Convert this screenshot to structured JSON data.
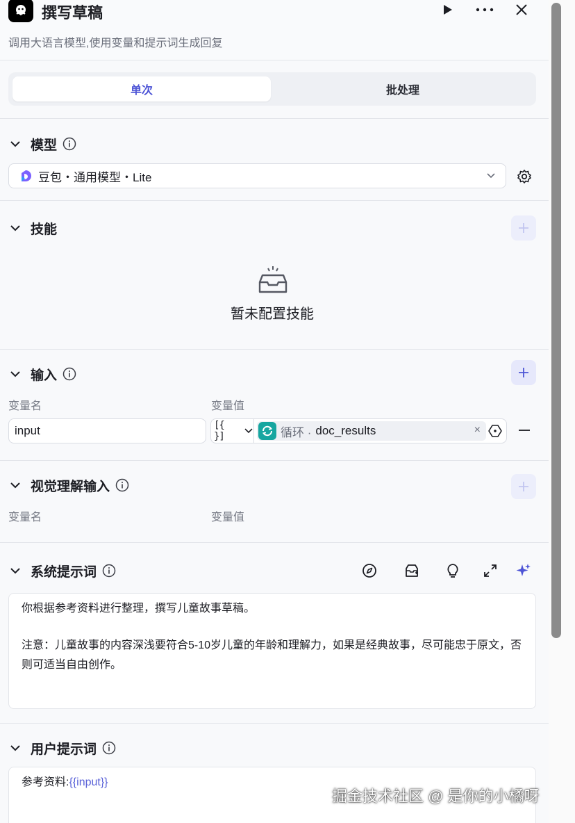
{
  "header": {
    "title": "撰写草稿",
    "subtitle": "调用大语言模型,使用变量和提示词生成回复"
  },
  "tabs": [
    {
      "label": "单次",
      "active": true
    },
    {
      "label": "批处理",
      "active": false
    }
  ],
  "model_section": {
    "title": "模型",
    "selected_model": "豆包・通用模型・Lite"
  },
  "skills_section": {
    "title": "技能",
    "empty_text": "暂未配置技能"
  },
  "input_section": {
    "title": "输入",
    "col_name": "变量名",
    "col_value": "变量值",
    "row": {
      "name": "input",
      "type_glyph": "[{ }]",
      "ref_node": "循环 ·",
      "ref_var": "doc_results"
    }
  },
  "vision_section": {
    "title": "视觉理解输入",
    "col_name": "变量名",
    "col_value": "变量值"
  },
  "system_prompt": {
    "title": "系统提示词",
    "para1": "你根据参考资料进行整理，撰写儿童故事草稿。",
    "para2": "注意：儿童故事的内容深浅要符合5-10岁儿童的年龄和理解力，如果是经典故事，尽可能忠于原文，否则可适当自由创作。"
  },
  "user_prompt": {
    "title": "用户提示词",
    "prefix": "参考资料:",
    "variable": "{{input}}"
  },
  "watermark": "掘金技术社区 @ 是你的小橘呀",
  "colors": {
    "accent": "#4e55d6",
    "loop_icon": "#16a6a0",
    "plus_bg": "#e6e8fb"
  }
}
